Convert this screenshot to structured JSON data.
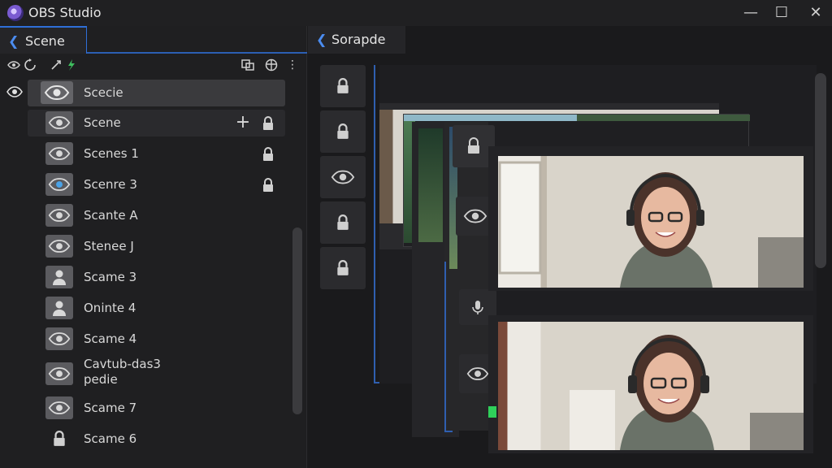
{
  "window": {
    "title": "OBS Studio",
    "minimize_glyph": "—",
    "maximize_glyph": "☐",
    "close_glyph": "✕"
  },
  "left_panel": {
    "tab_label": "Scene",
    "scenes": [
      {
        "label": "Scecie",
        "icon": "eye-icon",
        "selected": true,
        "lock": false,
        "plus": false
      },
      {
        "label": "Scene",
        "icon": "eye-icon",
        "selected": false,
        "hover": true,
        "lock": true,
        "plus": true
      },
      {
        "label": "Scenes 1",
        "icon": "eye-icon",
        "lock": true
      },
      {
        "label": "Scenre 3",
        "icon": "eye-icon-blue",
        "lock": true
      },
      {
        "label": "Scante A",
        "icon": "eye-icon"
      },
      {
        "label": "Stenee J",
        "icon": "eye-icon"
      },
      {
        "label": "Scame 3",
        "icon": "person-icon"
      },
      {
        "label": "Oninte 4",
        "icon": "person-icon"
      },
      {
        "label": "Scame 4",
        "icon": "eye-icon"
      },
      {
        "label": "Cavtub-das3",
        "label2": "pedie",
        "icon": "eye-icon"
      },
      {
        "label": "Scame 7",
        "icon": "eye-icon"
      },
      {
        "label": "Scame 6",
        "icon": "lock-icon"
      }
    ]
  },
  "right_panel": {
    "tab_label": "Sorapde"
  },
  "colors": {
    "accent": "#2f6fd8",
    "panel": "#1f1f21",
    "selected_row": "#3a3a3d"
  }
}
